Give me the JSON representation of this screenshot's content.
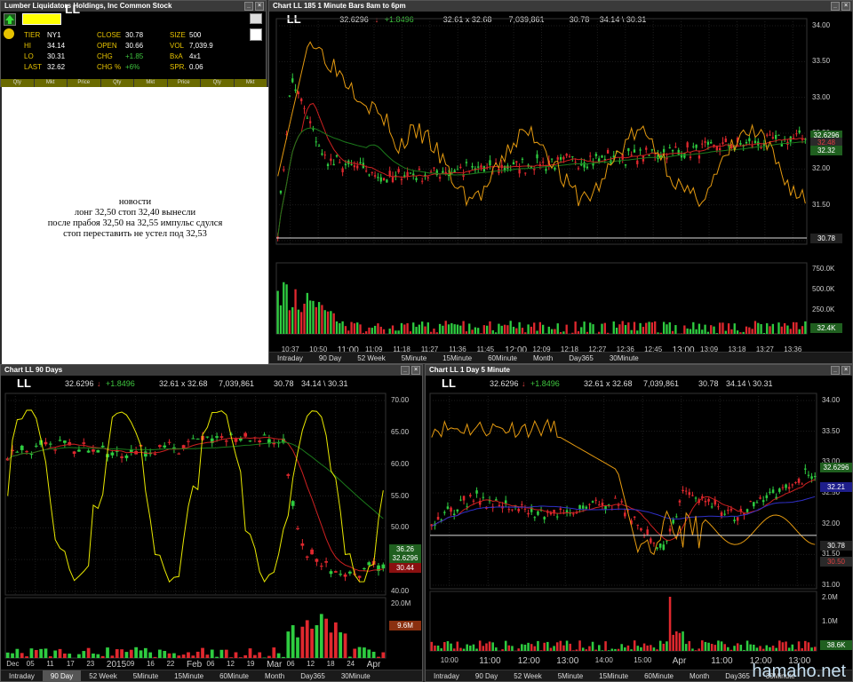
{
  "quote": {
    "title": "Lumber Liquidators Holdings, Inc Common Stock",
    "symbol": "LL",
    "rows": [
      [
        [
          "TIER",
          "NY1"
        ],
        [
          "CLOSE",
          "30.78"
        ],
        [
          "SIZE",
          "500"
        ]
      ],
      [
        [
          "HI",
          "34.14"
        ],
        [
          "OPEN",
          "30.66"
        ],
        [
          "VOL",
          "7,039.9"
        ]
      ],
      [
        [
          "LO",
          "30.31"
        ],
        [
          "CHG",
          "+1.85"
        ],
        [
          "BxA",
          "4x1"
        ]
      ],
      [
        [
          "LAST",
          "32.62"
        ],
        [
          "CHG %",
          "+6%"
        ],
        [
          "SPR.",
          "0.06"
        ]
      ]
    ],
    "cols": [
      "Qty",
      "Mkt",
      "Price",
      "Qty",
      "Mkt",
      "Price",
      "Qty",
      "Mkt"
    ]
  },
  "note": {
    "lines": [
      "новости",
      "лонг 32,50 стоп 32,40 вынесли",
      "после прабоя 32,50 на 32,55 импульс сдулся",
      "стоп переставить не устел под 32,53"
    ]
  },
  "hdr": {
    "symbol": "LL",
    "last": "32.6296",
    "change": "+1.8496",
    "bidask": "32.61 x 32.68",
    "volume": "7,039,861",
    "close": "30.78",
    "hilo": "34.14 \\ 30.31"
  },
  "chart1": {
    "title": "Chart LL 185 1 Minute Bars 8am to 6pm",
    "price_ticks": [
      "34.00",
      "33.50",
      "33.00",
      "32.50",
      "32.00",
      "31.50",
      "31.00"
    ],
    "tags": [
      "32.6296",
      "32.48",
      "32.32",
      "30.78"
    ],
    "vol_ticks": [
      "750.0K",
      "500.0K",
      "250.0K"
    ],
    "vol_tag": "32.4K",
    "time_ticks": [
      "10:37",
      "10:50",
      "11:00",
      "11:09",
      "11:18",
      "11:27",
      "11:36",
      "11:45",
      "12:00",
      "12:09",
      "12:18",
      "12:27",
      "12:36",
      "12:45",
      "13:00",
      "13:09",
      "13:18",
      "13:27",
      "13:36"
    ],
    "tabs": [
      "Intraday",
      "90 Day",
      "52 Week",
      "5Minute",
      "15Minute",
      "60Minute",
      "Month",
      "Day365",
      "30Minute"
    ],
    "active_tab": ""
  },
  "chart2": {
    "title": "Chart LL 90 Days",
    "price_ticks": [
      "70.00",
      "65.00",
      "60.00",
      "55.00",
      "50.00",
      "45.00",
      "40.00"
    ],
    "tags": [
      "36.26",
      "32.6296",
      "30.44"
    ],
    "vol_ticks": [
      "20.0M",
      "7.0M"
    ],
    "vol_tag2": "9.6M",
    "time_ticks": [
      "Dec",
      "05",
      "11",
      "17",
      "23",
      "2015",
      "09",
      "16",
      "22",
      "Feb",
      "06",
      "12",
      "19",
      "Mar",
      "06",
      "12",
      "18",
      "24",
      "Apr"
    ],
    "tabs": [
      "Intraday",
      "90 Day",
      "52 Week",
      "5Minute",
      "15Minute",
      "60Minute",
      "Month",
      "Day365",
      "30Minute"
    ],
    "active_tab": "90 Day"
  },
  "chart3": {
    "title": "Chart LL 1 Day 5 Minute",
    "price_ticks": [
      "34.00",
      "33.50",
      "33.00",
      "32.50",
      "32.00",
      "31.50",
      "31.00"
    ],
    "tags": [
      "32.6296",
      "32.21",
      "30.78",
      "30.50"
    ],
    "vol_ticks": [
      "2.0M",
      "1.0M"
    ],
    "vol_tag": "38.6K",
    "time_ticks": [
      "10:00",
      "11:00",
      "12:00",
      "13:00",
      "14:00",
      "15:00",
      "Apr",
      "11:00",
      "12:00",
      "13:00"
    ],
    "tabs": [
      "Intraday",
      "90 Day",
      "52 Week",
      "5Minute",
      "15Minute",
      "60Minute",
      "Month",
      "Day365",
      "30Minute"
    ],
    "active_tab": ""
  },
  "watermark": "hamaho.net",
  "colors": {
    "up": "#2ecc40",
    "down": "#e0282e",
    "osc": "#e59a10",
    "osc2": "#e8e800",
    "ma_red": "#cc2020",
    "ma_green": "#1b7a1b",
    "ma_blue": "#3030c8"
  }
}
